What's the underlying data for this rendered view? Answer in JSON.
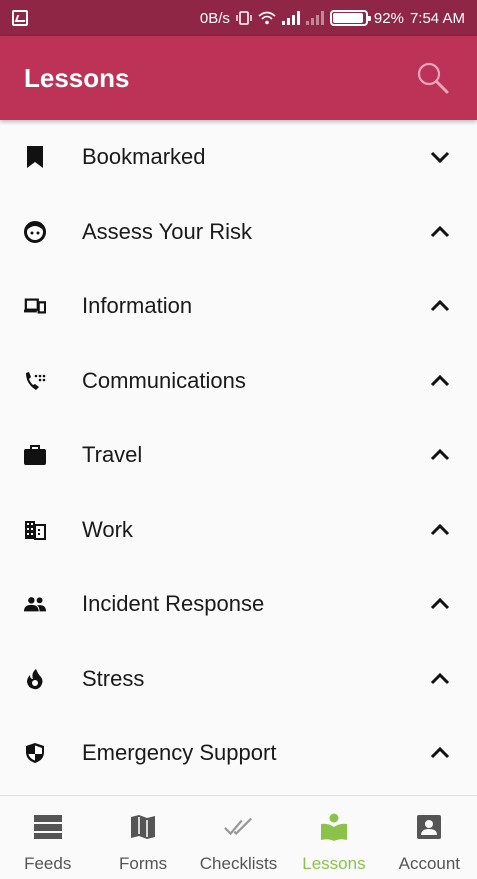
{
  "status_bar": {
    "net_speed": "0B/s",
    "battery": "92%",
    "time": "7:54 AM"
  },
  "app_bar": {
    "title": "Lessons"
  },
  "lessons": [
    {
      "label": "Bookmarked",
      "icon": "bookmark-icon",
      "expanded": false
    },
    {
      "label": "Assess Your Risk",
      "icon": "face-icon",
      "expanded": true
    },
    {
      "label": "Information",
      "icon": "devices-icon",
      "expanded": true
    },
    {
      "label": "Communications",
      "icon": "dialpad-phone-icon",
      "expanded": true
    },
    {
      "label": "Travel",
      "icon": "briefcase-icon",
      "expanded": true
    },
    {
      "label": "Work",
      "icon": "building-icon",
      "expanded": true
    },
    {
      "label": "Incident Response",
      "icon": "people-icon",
      "expanded": true
    },
    {
      "label": "Stress",
      "icon": "fire-icon",
      "expanded": true
    },
    {
      "label": "Emergency Support",
      "icon": "shield-icon",
      "expanded": true
    }
  ],
  "bottom_nav": [
    {
      "label": "Feeds",
      "icon": "feeds-icon",
      "active": false
    },
    {
      "label": "Forms",
      "icon": "map-icon",
      "active": false
    },
    {
      "label": "Checklists",
      "icon": "double-check-icon",
      "active": false
    },
    {
      "label": "Lessons",
      "icon": "book-reader-icon",
      "active": true
    },
    {
      "label": "Account",
      "icon": "account-box-icon",
      "active": false
    }
  ],
  "colors": {
    "status_bar": "#8f2646",
    "app_bar": "#bd3358",
    "active_tab": "#8bc34a",
    "inactive_tab": "#555555"
  }
}
